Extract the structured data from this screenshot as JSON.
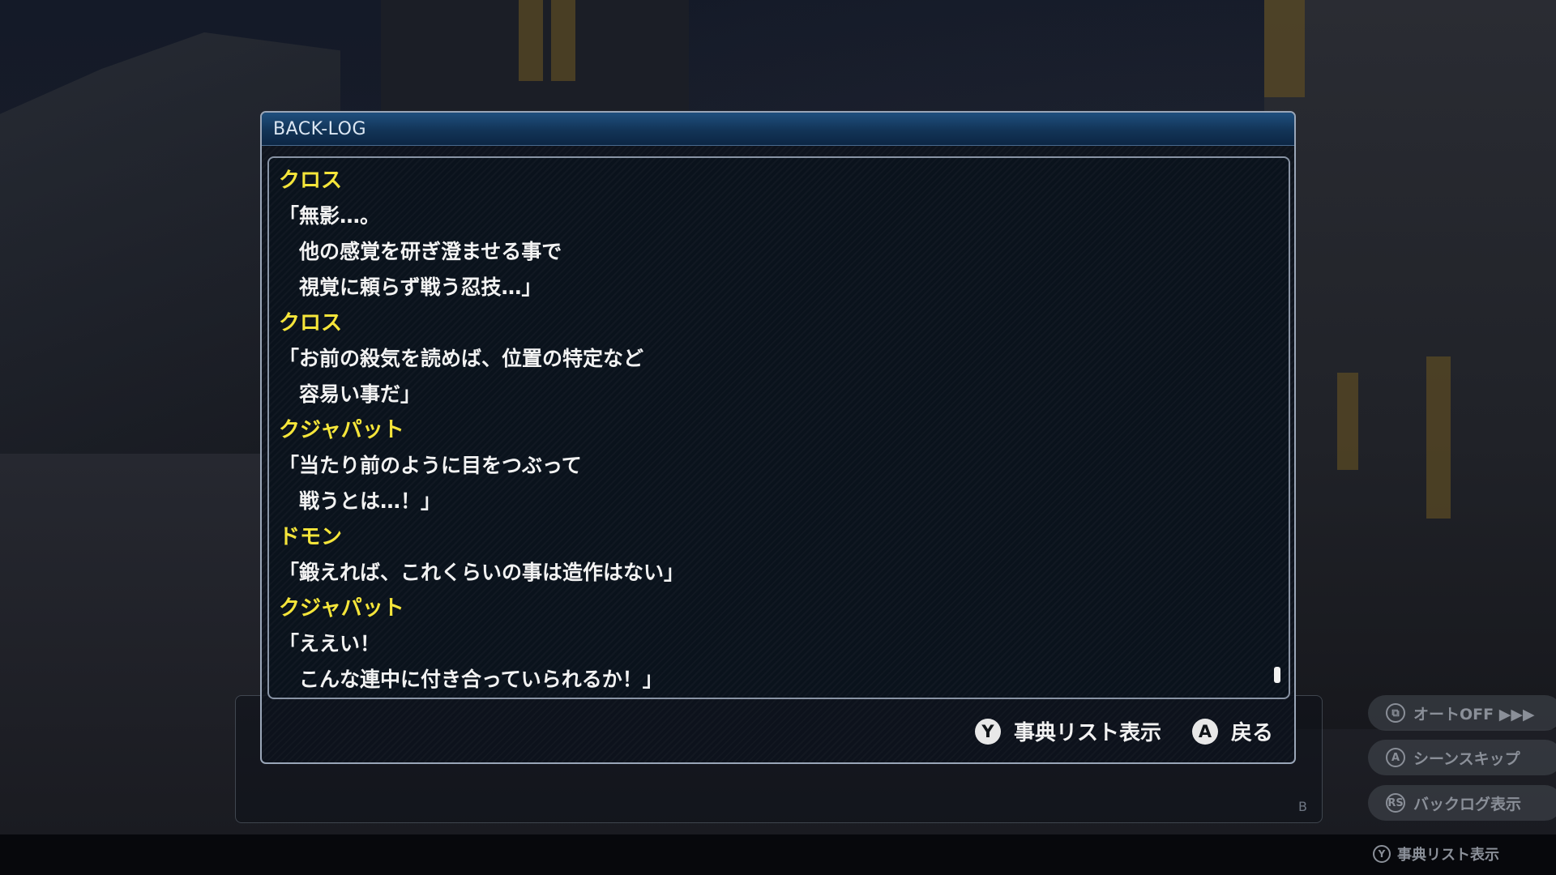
{
  "dialog": {
    "title": "BACK-LOG",
    "entries": [
      {
        "speaker": "クロス",
        "lines": [
          "「無影…。",
          "　他の感覚を研ぎ澄ませる事で",
          "　視覚に頼らず戦う忍技…」"
        ]
      },
      {
        "speaker": "クロス",
        "lines": [
          "「お前の殺気を読めば、位置の特定など",
          "　容易い事だ」"
        ]
      },
      {
        "speaker": "クジャパット",
        "lines": [
          "「当たり前のように目をつぶって",
          "　戦うとは…！」"
        ]
      },
      {
        "speaker": "ドモン",
        "lines": [
          "「鍛えれば、これくらいの事は造作はない」"
        ]
      },
      {
        "speaker": "クジャパット",
        "lines": [
          "「ええい！",
          "　こんな連中に付き合っていられるか！」"
        ]
      }
    ],
    "scroll_position": 1.0,
    "footer": {
      "y_button": "Y",
      "y_label": "事典リスト表示",
      "a_button": "A",
      "a_label": "戻る"
    }
  },
  "side_menu": {
    "auto": {
      "icon": "⧉",
      "label": "オートOFF ▶▶▶"
    },
    "skip": {
      "icon": "A",
      "label": "シーンスキップ"
    },
    "backlog": {
      "icon": "RS",
      "label": "バックログ表示"
    },
    "dict": {
      "icon": "Y",
      "label": "事典リスト表示"
    }
  },
  "message_box": {
    "letter": "B"
  },
  "colors": {
    "speaker": "#f5e53a",
    "text": "#f2f2f2",
    "header": "#123457"
  }
}
